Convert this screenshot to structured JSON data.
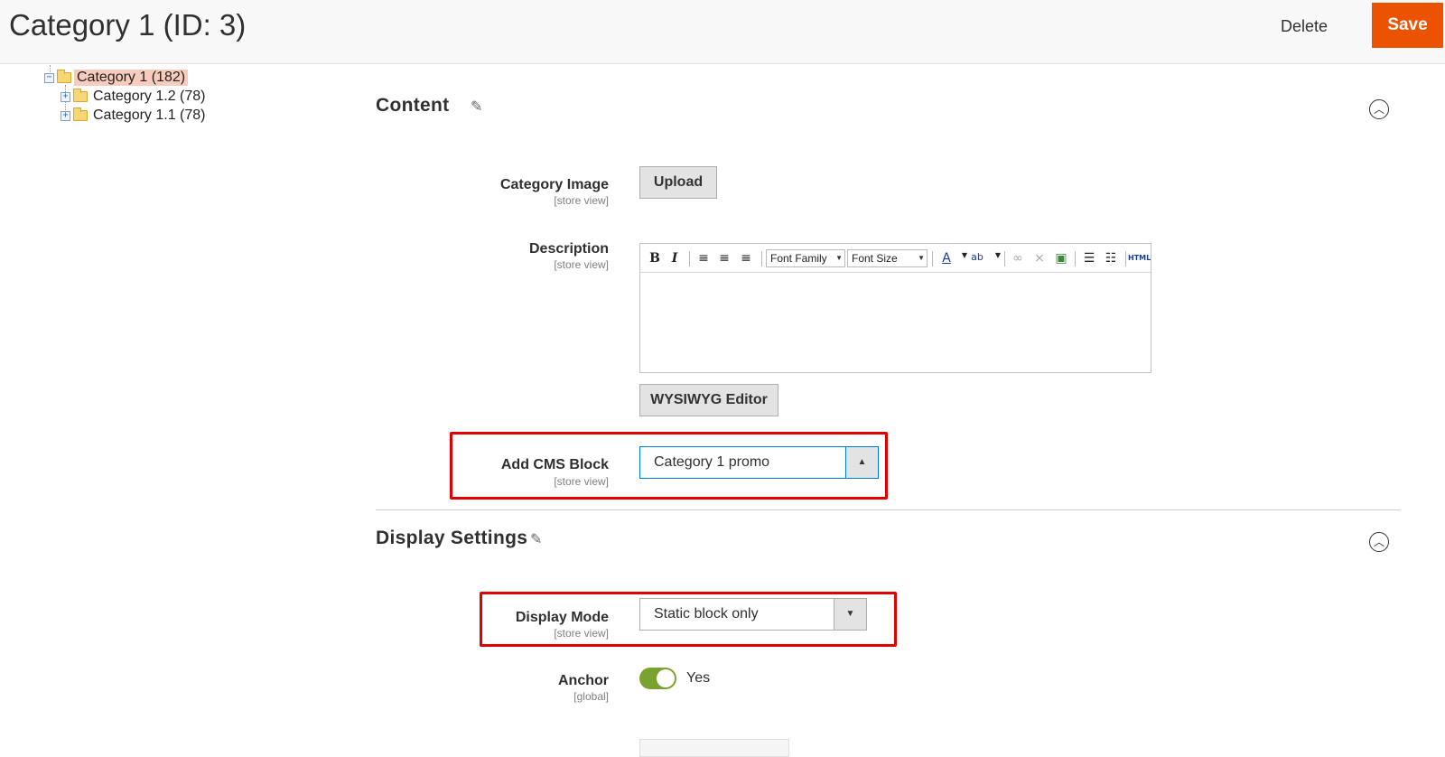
{
  "header": {
    "title": "Category 1 (ID: 3)",
    "delete_label": "Delete",
    "save_label": "Save",
    "save_color": "#eb5202"
  },
  "tree": {
    "items": [
      {
        "label": "Category 1 (182)",
        "active": true,
        "toggle": "−"
      },
      {
        "label": "Category 1.2 (78)",
        "active": false,
        "toggle": "+"
      },
      {
        "label": "Category 1.1 (78)",
        "active": false,
        "toggle": "+"
      }
    ]
  },
  "content_section": {
    "title": "Content",
    "category_image": {
      "label": "Category Image",
      "scope": "[store view]",
      "button": "Upload"
    },
    "description": {
      "label": "Description",
      "scope": "[store view]",
      "toolbar": {
        "font_family": "Font Family",
        "font_size": "Font Size",
        "bold": "B",
        "italic": "I",
        "html": "HTML"
      },
      "wysiwyg_button": "WYSIWYG Editor"
    },
    "cms_block": {
      "label": "Add CMS Block",
      "scope": "[store view]",
      "value": "Category 1 promo"
    }
  },
  "display_section": {
    "title": "Display Settings",
    "display_mode": {
      "label": "Display Mode",
      "scope": "[store view]",
      "value": "Static block only"
    },
    "anchor": {
      "label": "Anchor",
      "scope": "[global]",
      "value": "Yes"
    }
  },
  "colors": {
    "accent": "#eb5202",
    "toggle_on": "#79a22e",
    "highlight_box": "#e00000",
    "active_tree_bg": "#f8ccbc"
  }
}
